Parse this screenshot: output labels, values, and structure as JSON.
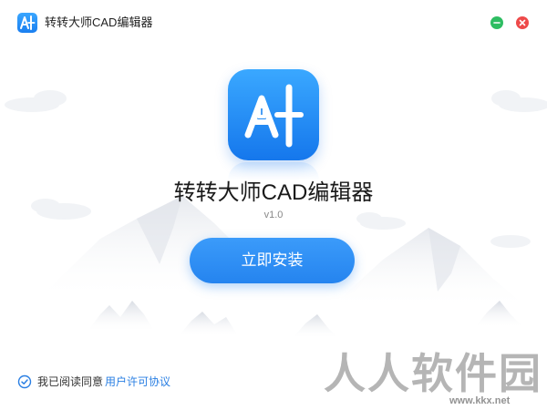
{
  "window": {
    "title": "转转大师CAD编辑器",
    "minimize_color": "#2ebd62",
    "close_color": "#ee4a4a"
  },
  "product": {
    "logo_text": "A",
    "name": "转转大师CAD编辑器",
    "version": "v1.0"
  },
  "actions": {
    "install_label": "立即安装"
  },
  "agreement": {
    "checked": true,
    "text": "我已阅读同意",
    "link": "用户许可协议"
  },
  "watermark": {
    "text": "人人软件园",
    "url": "www.kkx.net"
  },
  "colors": {
    "accent": "#2584ef",
    "link": "#2a7fe3"
  }
}
